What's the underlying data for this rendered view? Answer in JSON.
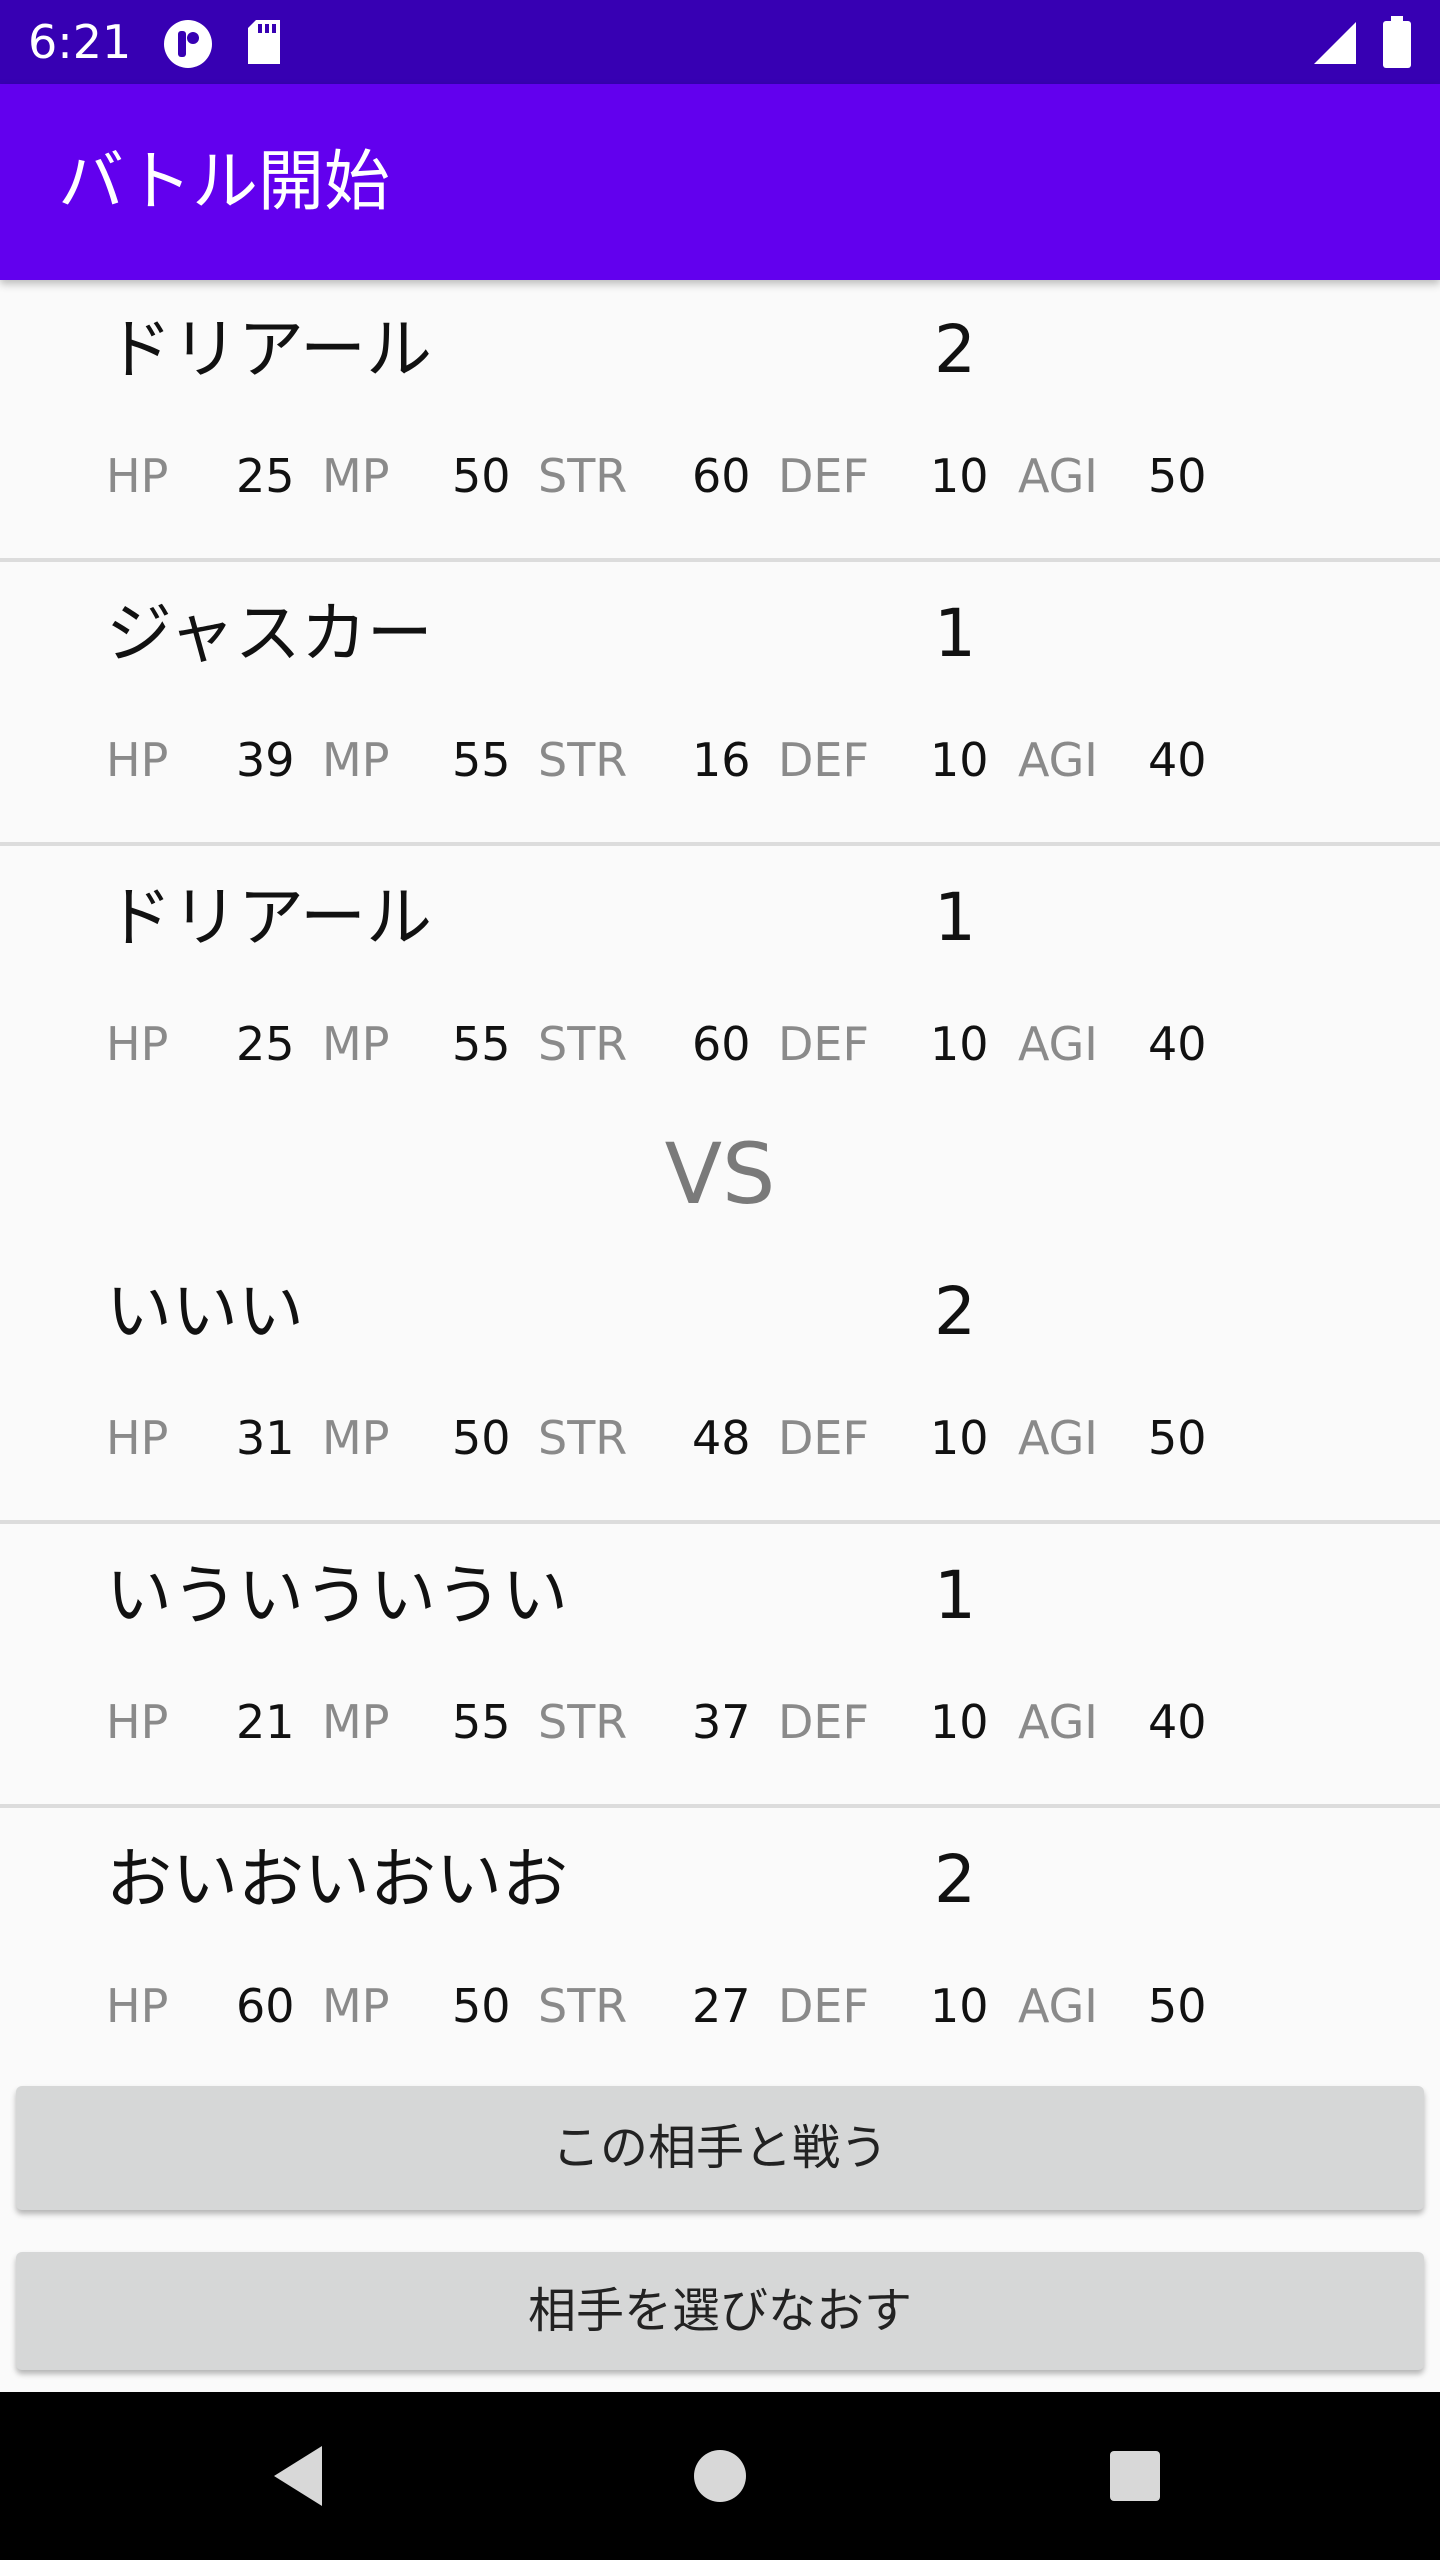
{
  "status_bar": {
    "time": "6:21",
    "icons": [
      "app-notification-icon",
      "sd-card-icon",
      "signal-icon",
      "battery-icon"
    ]
  },
  "app_bar": {
    "title": "バトル開始"
  },
  "stat_labels": {
    "hp": "HP",
    "mp": "MP",
    "str": "STR",
    "def": "DEF",
    "agi": "AGI"
  },
  "ally_party": [
    {
      "name": "ドリアール",
      "level": "2",
      "hp": "25",
      "mp": "50",
      "str": "60",
      "def": "10",
      "agi": "50"
    },
    {
      "name": "ジャスカー",
      "level": "1",
      "hp": "39",
      "mp": "55",
      "str": "16",
      "def": "10",
      "agi": "40"
    },
    {
      "name": "ドリアール",
      "level": "1",
      "hp": "25",
      "mp": "55",
      "str": "60",
      "def": "10",
      "agi": "40"
    }
  ],
  "vs_label": "VS",
  "enemy_party": [
    {
      "name": "いいい",
      "level": "2",
      "hp": "31",
      "mp": "50",
      "str": "48",
      "def": "10",
      "agi": "50"
    },
    {
      "name": "いういういうい",
      "level": "1",
      "hp": "21",
      "mp": "55",
      "str": "37",
      "def": "10",
      "agi": "40"
    },
    {
      "name": "おいおいおいお",
      "level": "2",
      "hp": "60",
      "mp": "50",
      "str": "27",
      "def": "10",
      "agi": "50"
    }
  ],
  "buttons": {
    "fight": "この相手と戦う",
    "reselect": "相手を選びなおす"
  },
  "nav_bar": {
    "icons": [
      "back-icon",
      "home-icon",
      "recents-icon"
    ]
  },
  "colors": {
    "status_bar": "#3700b3",
    "app_bar": "#6200ee",
    "background": "#fafafa",
    "button": "#d6d7d7"
  }
}
